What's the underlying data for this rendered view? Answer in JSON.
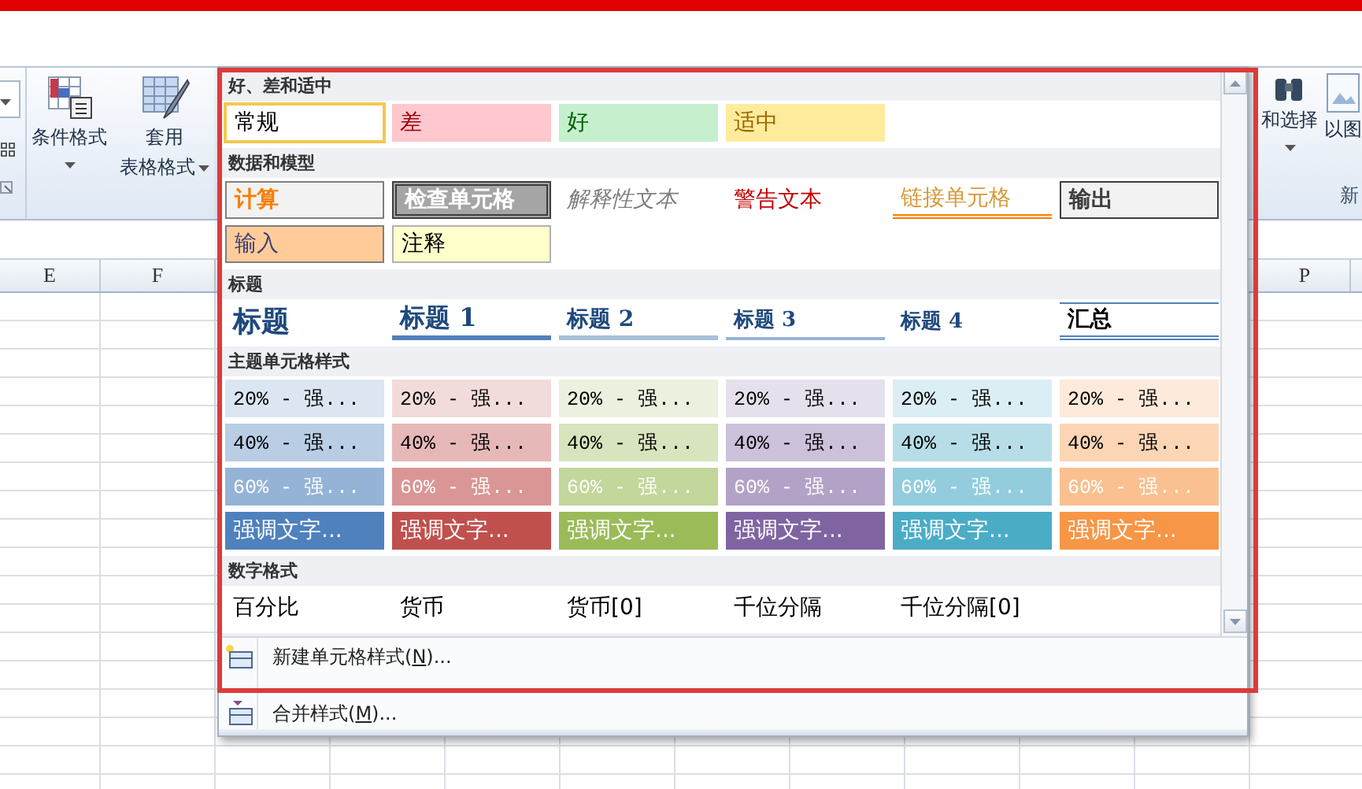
{
  "ribbon": {
    "buttons": [
      {
        "kind": "conditional",
        "lines": [
          "条件格式"
        ]
      },
      {
        "kind": "table",
        "lines": [
          "套用",
          "表格格式"
        ]
      }
    ],
    "right_buttons": [
      {
        "kind": "find",
        "lines": [
          "和选择"
        ]
      },
      {
        "kind": "picture",
        "lines": [
          "以图"
        ]
      }
    ],
    "group_label": "新"
  },
  "sheet": {
    "columns_left": [
      "E",
      "F"
    ],
    "columns_right": [
      "P"
    ]
  },
  "style_panel": {
    "sections": [
      {
        "title": "好、差和适中",
        "kind": "cells",
        "cells": [
          {
            "label": "常规",
            "kind": "normal",
            "selected": true
          },
          {
            "label": "差",
            "kind": "bad",
            "selected": false
          },
          {
            "label": "好",
            "kind": "good",
            "selected": false
          },
          {
            "label": "适中",
            "kind": "neutral",
            "selected": false
          }
        ]
      },
      {
        "title": "数据和模型",
        "kind": "cells",
        "cells": [
          {
            "label": "计算",
            "kind": "calculation",
            "selected": false
          },
          {
            "label": "检查单元格",
            "kind": "check",
            "selected": false
          },
          {
            "label": "解释性文本",
            "kind": "explanatory",
            "selected": false
          },
          {
            "label": "警告文本",
            "kind": "warning",
            "selected": false
          },
          {
            "label": "链接单元格",
            "kind": "linked",
            "selected": false
          },
          {
            "label": "输出",
            "kind": "output",
            "selected": false
          },
          {
            "label": "输入",
            "kind": "input",
            "selected": false
          },
          {
            "label": "注释",
            "kind": "note",
            "selected": false
          }
        ]
      },
      {
        "title": "标题",
        "kind": "cells",
        "cells": [
          {
            "label": "标题",
            "kind": "title",
            "selected": false
          },
          {
            "label": "标题 1",
            "kind": "heading1",
            "selected": false
          },
          {
            "label": "标题 2",
            "kind": "heading2",
            "selected": false
          },
          {
            "label": "标题 3",
            "kind": "heading3",
            "selected": false
          },
          {
            "label": "标题 4",
            "kind": "heading4",
            "selected": false
          },
          {
            "label": "汇总",
            "kind": "total",
            "selected": false
          }
        ]
      },
      {
        "title": "主题单元格样式",
        "kind": "theme",
        "columns": [
          {
            "color": "#4f81bd",
            "cells": [
              {
                "label": "20% - 强...",
                "kind": "tint20"
              },
              {
                "label": "40% - 强...",
                "kind": "tint40"
              },
              {
                "label": "60% - 强...",
                "kind": "tint60"
              },
              {
                "label": "强调文字...",
                "kind": "accent"
              }
            ]
          },
          {
            "color": "#c0504d",
            "cells": [
              {
                "label": "20% - 强...",
                "kind": "tint20"
              },
              {
                "label": "40% - 强...",
                "kind": "tint40"
              },
              {
                "label": "60% - 强...",
                "kind": "tint60"
              },
              {
                "label": "强调文字...",
                "kind": "accent"
              }
            ]
          },
          {
            "color": "#9bbb59",
            "cells": [
              {
                "label": "20% - 强...",
                "kind": "tint20"
              },
              {
                "label": "40% - 强...",
                "kind": "tint40"
              },
              {
                "label": "60% - 强...",
                "kind": "tint60"
              },
              {
                "label": "强调文字...",
                "kind": "accent"
              }
            ]
          },
          {
            "color": "#8064a2",
            "cells": [
              {
                "label": "20% - 强...",
                "kind": "tint20"
              },
              {
                "label": "40% - 强...",
                "kind": "tint40"
              },
              {
                "label": "60% - 强...",
                "kind": "tint60"
              },
              {
                "label": "强调文字...",
                "kind": "accent"
              }
            ]
          },
          {
            "color": "#4bacc6",
            "cells": [
              {
                "label": "20% - 强...",
                "kind": "tint20"
              },
              {
                "label": "40% - 强...",
                "kind": "tint40"
              },
              {
                "label": "60% - 强...",
                "kind": "tint60"
              },
              {
                "label": "强调文字...",
                "kind": "accent"
              }
            ]
          },
          {
            "color": "#f79646",
            "cells": [
              {
                "label": "20% - 强...",
                "kind": "tint20"
              },
              {
                "label": "40% - 强...",
                "kind": "tint40"
              },
              {
                "label": "60% - 强...",
                "kind": "tint60"
              },
              {
                "label": "强调文字...",
                "kind": "accent"
              }
            ]
          }
        ]
      },
      {
        "title": "数字格式",
        "kind": "cells",
        "cells": [
          {
            "label": "百分比",
            "kind": "number",
            "selected": false
          },
          {
            "label": "货币",
            "kind": "number",
            "selected": false
          },
          {
            "label": "货币[0]",
            "kind": "number",
            "selected": false
          },
          {
            "label": "千位分隔",
            "kind": "number",
            "selected": false
          },
          {
            "label": "千位分隔[0]",
            "kind": "number",
            "selected": false
          }
        ]
      }
    ],
    "menu": [
      {
        "label": "新建单元格样式(",
        "key": "N",
        "suffix": ")...",
        "kind": "new"
      },
      {
        "label": "合并样式(",
        "key": "M",
        "suffix": ")...",
        "kind": "merge"
      }
    ]
  }
}
